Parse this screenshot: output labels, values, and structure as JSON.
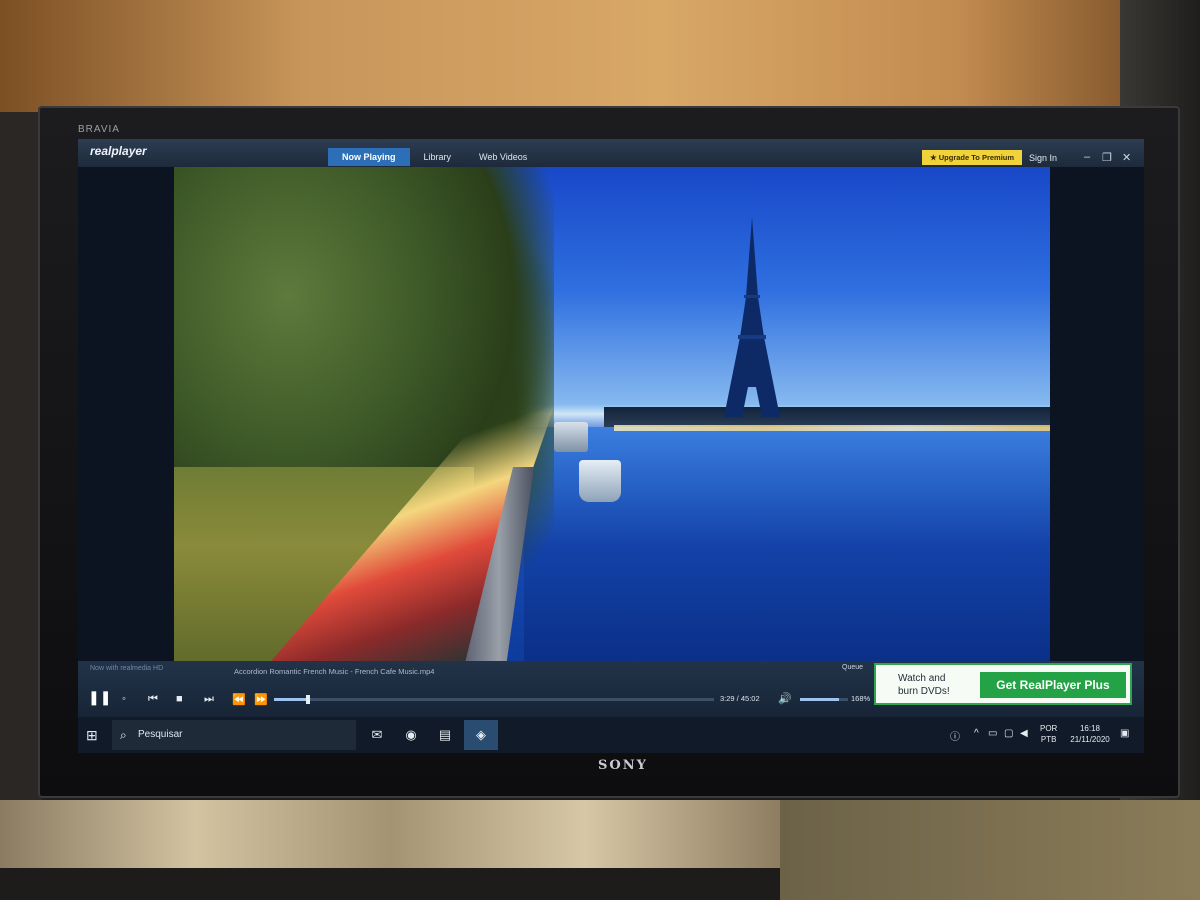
{
  "tv": {
    "brand": "BRAVIA",
    "maker": "SONY"
  },
  "player": {
    "logo": "realplayer",
    "tabs": [
      {
        "label": "Now Playing",
        "active": true
      },
      {
        "label": "Library",
        "active": false
      },
      {
        "label": "Web Videos",
        "active": false
      }
    ],
    "upgrade_label": "★ Upgrade To Premium",
    "signin_label": "Sign In",
    "window_controls": {
      "minimize": "–",
      "restore": "❐",
      "close": "✕"
    },
    "now_with": "Now with realmedia HD",
    "file_name": "Accordion Romantic French Music - French Cafe Music.mp4",
    "queue_label": "Queue",
    "time_display": "3:29 / 45:02",
    "progress_fraction": 0.077,
    "volume_percent_label": "168%",
    "volume_fraction": 0.82,
    "ad": {
      "text": "Watch and burn DVDs!",
      "button": "Get RealPlayer Plus"
    }
  },
  "taskbar": {
    "search_placeholder": "Pesquisar",
    "apps": [
      "mail-icon",
      "chrome-icon",
      "file-explorer-icon",
      "realplayer-icon"
    ],
    "lang_top": "POR",
    "lang_bottom": "PTB",
    "time": "16:18",
    "date": "21/11/2020"
  }
}
